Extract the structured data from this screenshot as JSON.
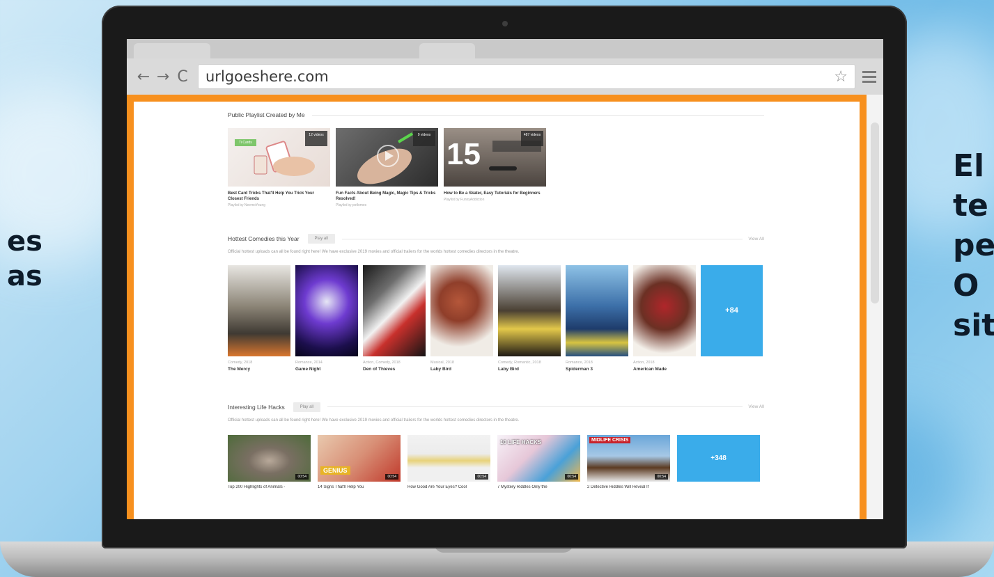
{
  "background": {
    "left_text": [
      "es",
      "as"
    ],
    "right_text": [
      "El",
      "te",
      "pe",
      "O",
      "sit"
    ]
  },
  "browser": {
    "url": "urlgoeshere.com",
    "back_icon": "←",
    "forward_icon": "→",
    "reload_icon": "C",
    "star_icon": "☆"
  },
  "playlists": {
    "heading": "Public Playlist Created by Me",
    "items": [
      {
        "title": "Best Card Tricks That'll Help You Trick Your Closest Friends",
        "sub": "Playlist by NeemoYoung",
        "count": "12 videos",
        "badge": "Ti Cards"
      },
      {
        "title": "Fun Facts About Being Magic, Magic Tips & Tricks Resolved!",
        "sub": "Playlist by potlomes",
        "count": "9 videos"
      },
      {
        "title": "How to Be a Skater, Easy Tutorials for Beginners",
        "sub": "Playlist by FunnyAddiction",
        "count": "487 videos"
      }
    ]
  },
  "comedies": {
    "heading": "Hottest Comedies this Year",
    "play_all": "Play all",
    "view_all": "View All",
    "description": "Official hottest uploads can all be found right here! We have exclusive 2019 movies and official trailers for the worlds hottest comedies directors in the theatre.",
    "more": "+84",
    "items": [
      {
        "meta": "Comedy, 2018",
        "title": "The Mercy"
      },
      {
        "meta": "Romance, 2014",
        "title": "Game Night"
      },
      {
        "meta": "Action, Comedy, 2018",
        "title": "Den of Thieves"
      },
      {
        "meta": "Musical, 2018",
        "title": "Laby Bird"
      },
      {
        "meta": "Comedy, Romantic, 2018",
        "title": "Laby Bird"
      },
      {
        "meta": "Romance, 2018",
        "title": "Spiderman 3"
      },
      {
        "meta": "Action, 2018",
        "title": "American Made"
      }
    ]
  },
  "lifehacks": {
    "heading": "Interesting Life Hacks",
    "play_all": "Play all",
    "view_all": "View All",
    "description": "Official hottest uploads can all be found right here! We have exclusive 2019 movies and official trailers for the worlds hottest comedies directors in the theatre.",
    "more": "+348",
    "items": [
      {
        "title": "Top 200 Highlights of Animals -",
        "duration": "00:54"
      },
      {
        "title": "14 Signs That'll Help You",
        "duration": "00:54",
        "overlay": "GENIUS"
      },
      {
        "title": "How Good Are Your Eyes? Cool",
        "duration": "00:54"
      },
      {
        "title": "7 Mystery Riddles Only the",
        "duration": "00:54",
        "overlay": "10 LIFE HACKS"
      },
      {
        "title": "2 Detective Riddles Will Reveal If",
        "duration": "00:54",
        "overlay": "MIDLIFE CRISIS"
      }
    ]
  }
}
